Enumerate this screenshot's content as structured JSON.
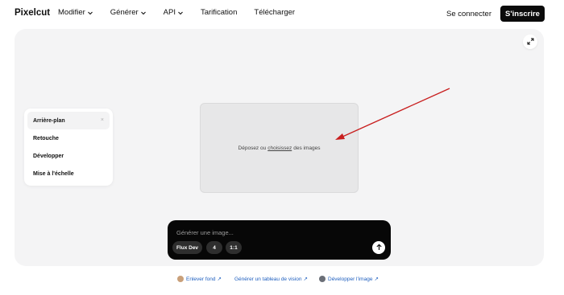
{
  "header": {
    "logo": "Pixelcut",
    "nav": [
      {
        "label": "Modifier",
        "has_dropdown": true
      },
      {
        "label": "Générer",
        "has_dropdown": true
      },
      {
        "label": "API",
        "has_dropdown": true
      },
      {
        "label": "Tarification",
        "has_dropdown": false
      },
      {
        "label": "Télécharger",
        "has_dropdown": false
      }
    ],
    "login_label": "Se connecter",
    "signup_label": "S'inscrire"
  },
  "workspace": {
    "expand_icon": "expand-icon",
    "tools": [
      {
        "label": "Arrière-plan",
        "active": true,
        "close": "×"
      },
      {
        "label": "Retouche"
      },
      {
        "label": "Développer"
      },
      {
        "label": "Mise à l'échelle"
      }
    ],
    "dropzone": {
      "prefix": "Déposez ou",
      "link": "choisissez",
      "suffix": "des images"
    }
  },
  "prompt": {
    "placeholder": "Générer une image...",
    "chips": [
      "Flux Dev",
      "4",
      "1:1"
    ],
    "send_icon": "arrow-up-icon"
  },
  "quick_links": [
    {
      "label": "Enlever fond",
      "ext": "↗"
    },
    {
      "label": "Générer un tableau de vision",
      "ext": "↗"
    },
    {
      "label": "Développer l'image",
      "ext": "↗"
    }
  ],
  "colors": {
    "accent_dark": "#0b0b0b",
    "link_blue": "#1f5fbf",
    "arrow_red": "#c81e1e",
    "workspace_bg": "#f4f4f5"
  }
}
